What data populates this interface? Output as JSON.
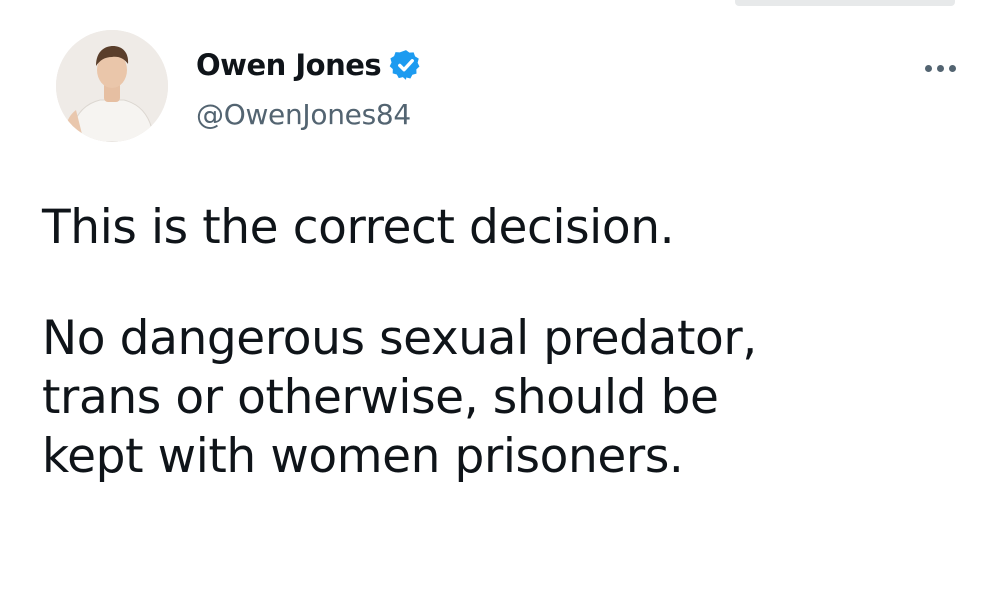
{
  "author": {
    "display_name": "Owen Jones",
    "handle": "@OwenJones84",
    "verified": true,
    "verified_color": "#1d9bf0"
  },
  "menu": {
    "icon": "more-horizontal-icon"
  },
  "tweet": {
    "paragraphs": [
      {
        "lines": [
          "This is the correct decision."
        ]
      },
      {
        "lines": [
          "No dangerous sexual predator,",
          "trans or otherwise, should be",
          "kept with women prisoners."
        ]
      }
    ]
  },
  "colors": {
    "text_primary": "#0f1419",
    "text_secondary": "#536471",
    "background": "#ffffff"
  }
}
